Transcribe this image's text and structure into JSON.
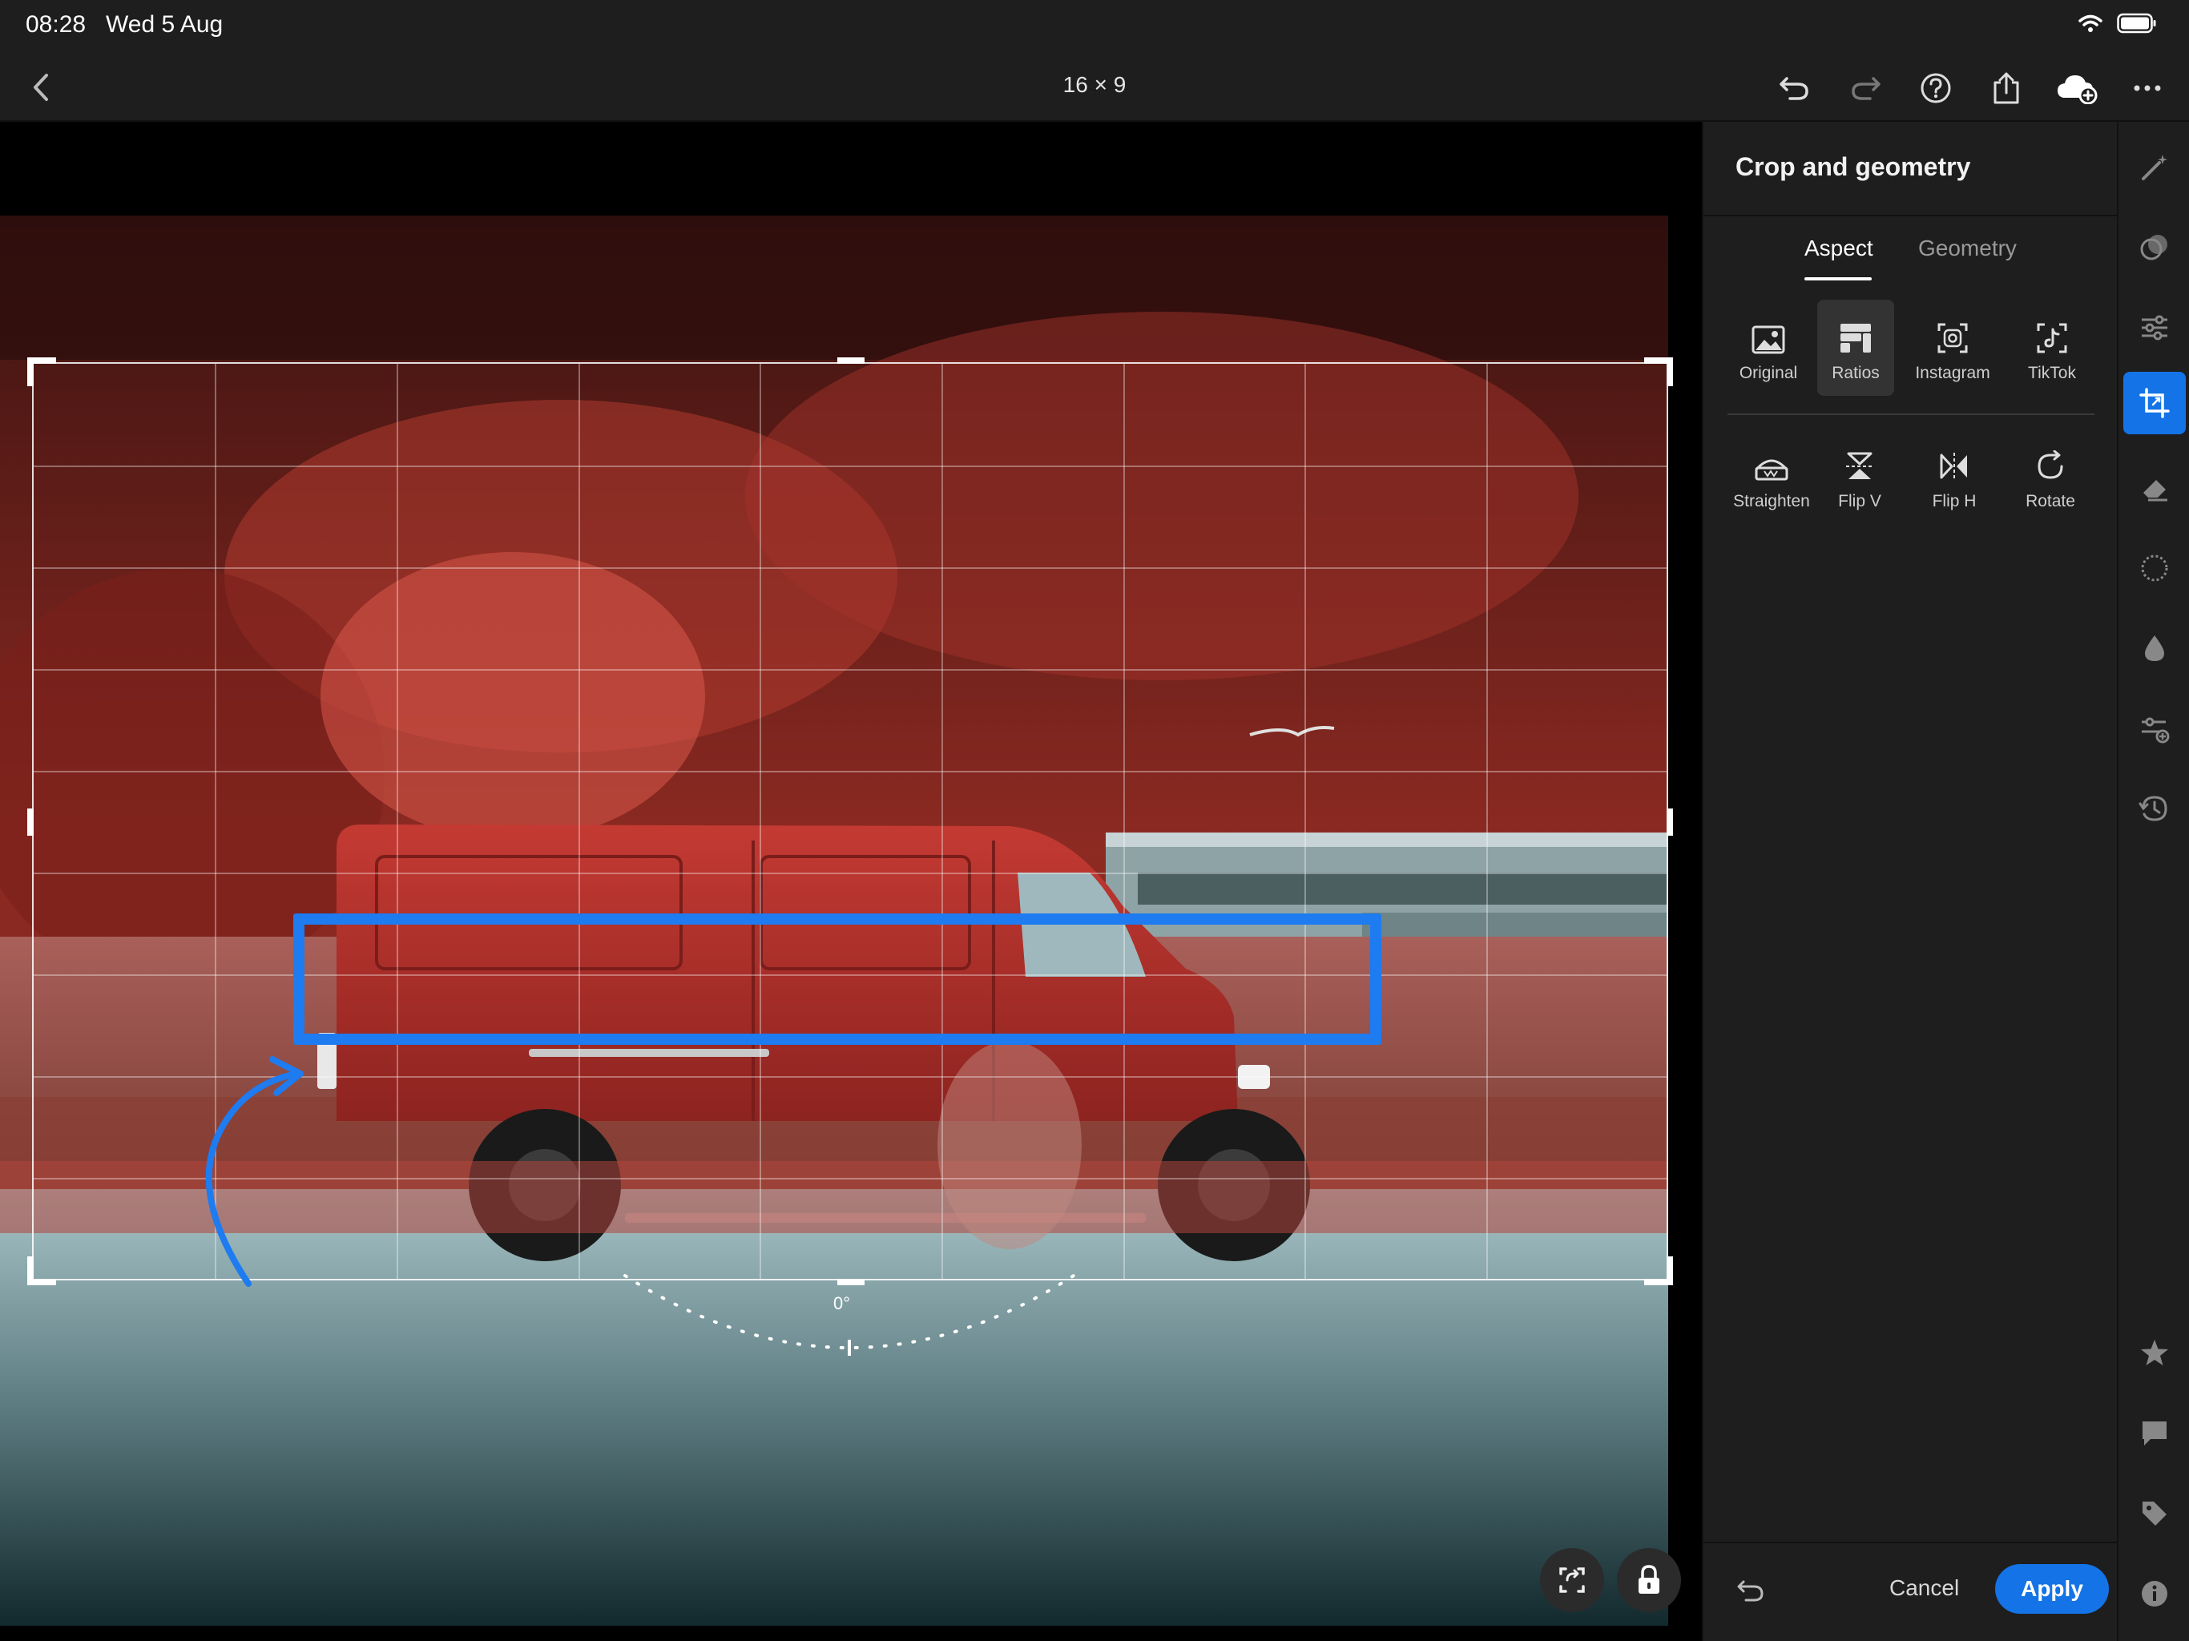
{
  "status_bar": {
    "time": "08:28",
    "date": "Wed 5 Aug",
    "icons": [
      "wifi-icon",
      "battery-icon"
    ]
  },
  "toolbar": {
    "title": "16 × 9",
    "icons": [
      "back-chevron-icon",
      "undo-icon",
      "redo-icon",
      "help-icon",
      "share-icon",
      "cloud-add-icon",
      "more-icon"
    ]
  },
  "canvas": {
    "angle_label": "0°",
    "highlight_color": "#1e7bf0",
    "floating_buttons": [
      "rotate-crop-icon",
      "lock-icon"
    ]
  },
  "panel": {
    "title": "Crop and geometry",
    "tabs": [
      {
        "label": "Aspect",
        "active": true
      },
      {
        "label": "Geometry",
        "active": false
      }
    ],
    "aspect_options": [
      {
        "label": "Original",
        "icon": "image-icon",
        "selected": false
      },
      {
        "label": "Ratios",
        "icon": "ratios-icon",
        "selected": true
      },
      {
        "label": "Instagram",
        "icon": "instagram-icon",
        "selected": false
      },
      {
        "label": "TikTok",
        "icon": "tiktok-icon",
        "selected": false
      }
    ],
    "geometry_options": [
      {
        "label": "Straighten",
        "icon": "straighten-icon"
      },
      {
        "label": "Flip V",
        "icon": "flip-vertical-icon"
      },
      {
        "label": "Flip H",
        "icon": "flip-horizontal-icon"
      },
      {
        "label": "Rotate",
        "icon": "rotate-icon"
      }
    ],
    "cancel_label": "Cancel",
    "apply_label": "Apply",
    "accent_color": "#1473e6"
  },
  "rail": {
    "icons": [
      "auto-wand-icon",
      "presets-icon",
      "adjust-sliders-icon",
      "crop-icon",
      "eraser-icon",
      "selective-icon",
      "blur-icon",
      "versions-icon",
      "history-icon",
      "star-icon",
      "comment-icon",
      "tag-icon",
      "info-icon"
    ],
    "active": "crop-icon"
  }
}
